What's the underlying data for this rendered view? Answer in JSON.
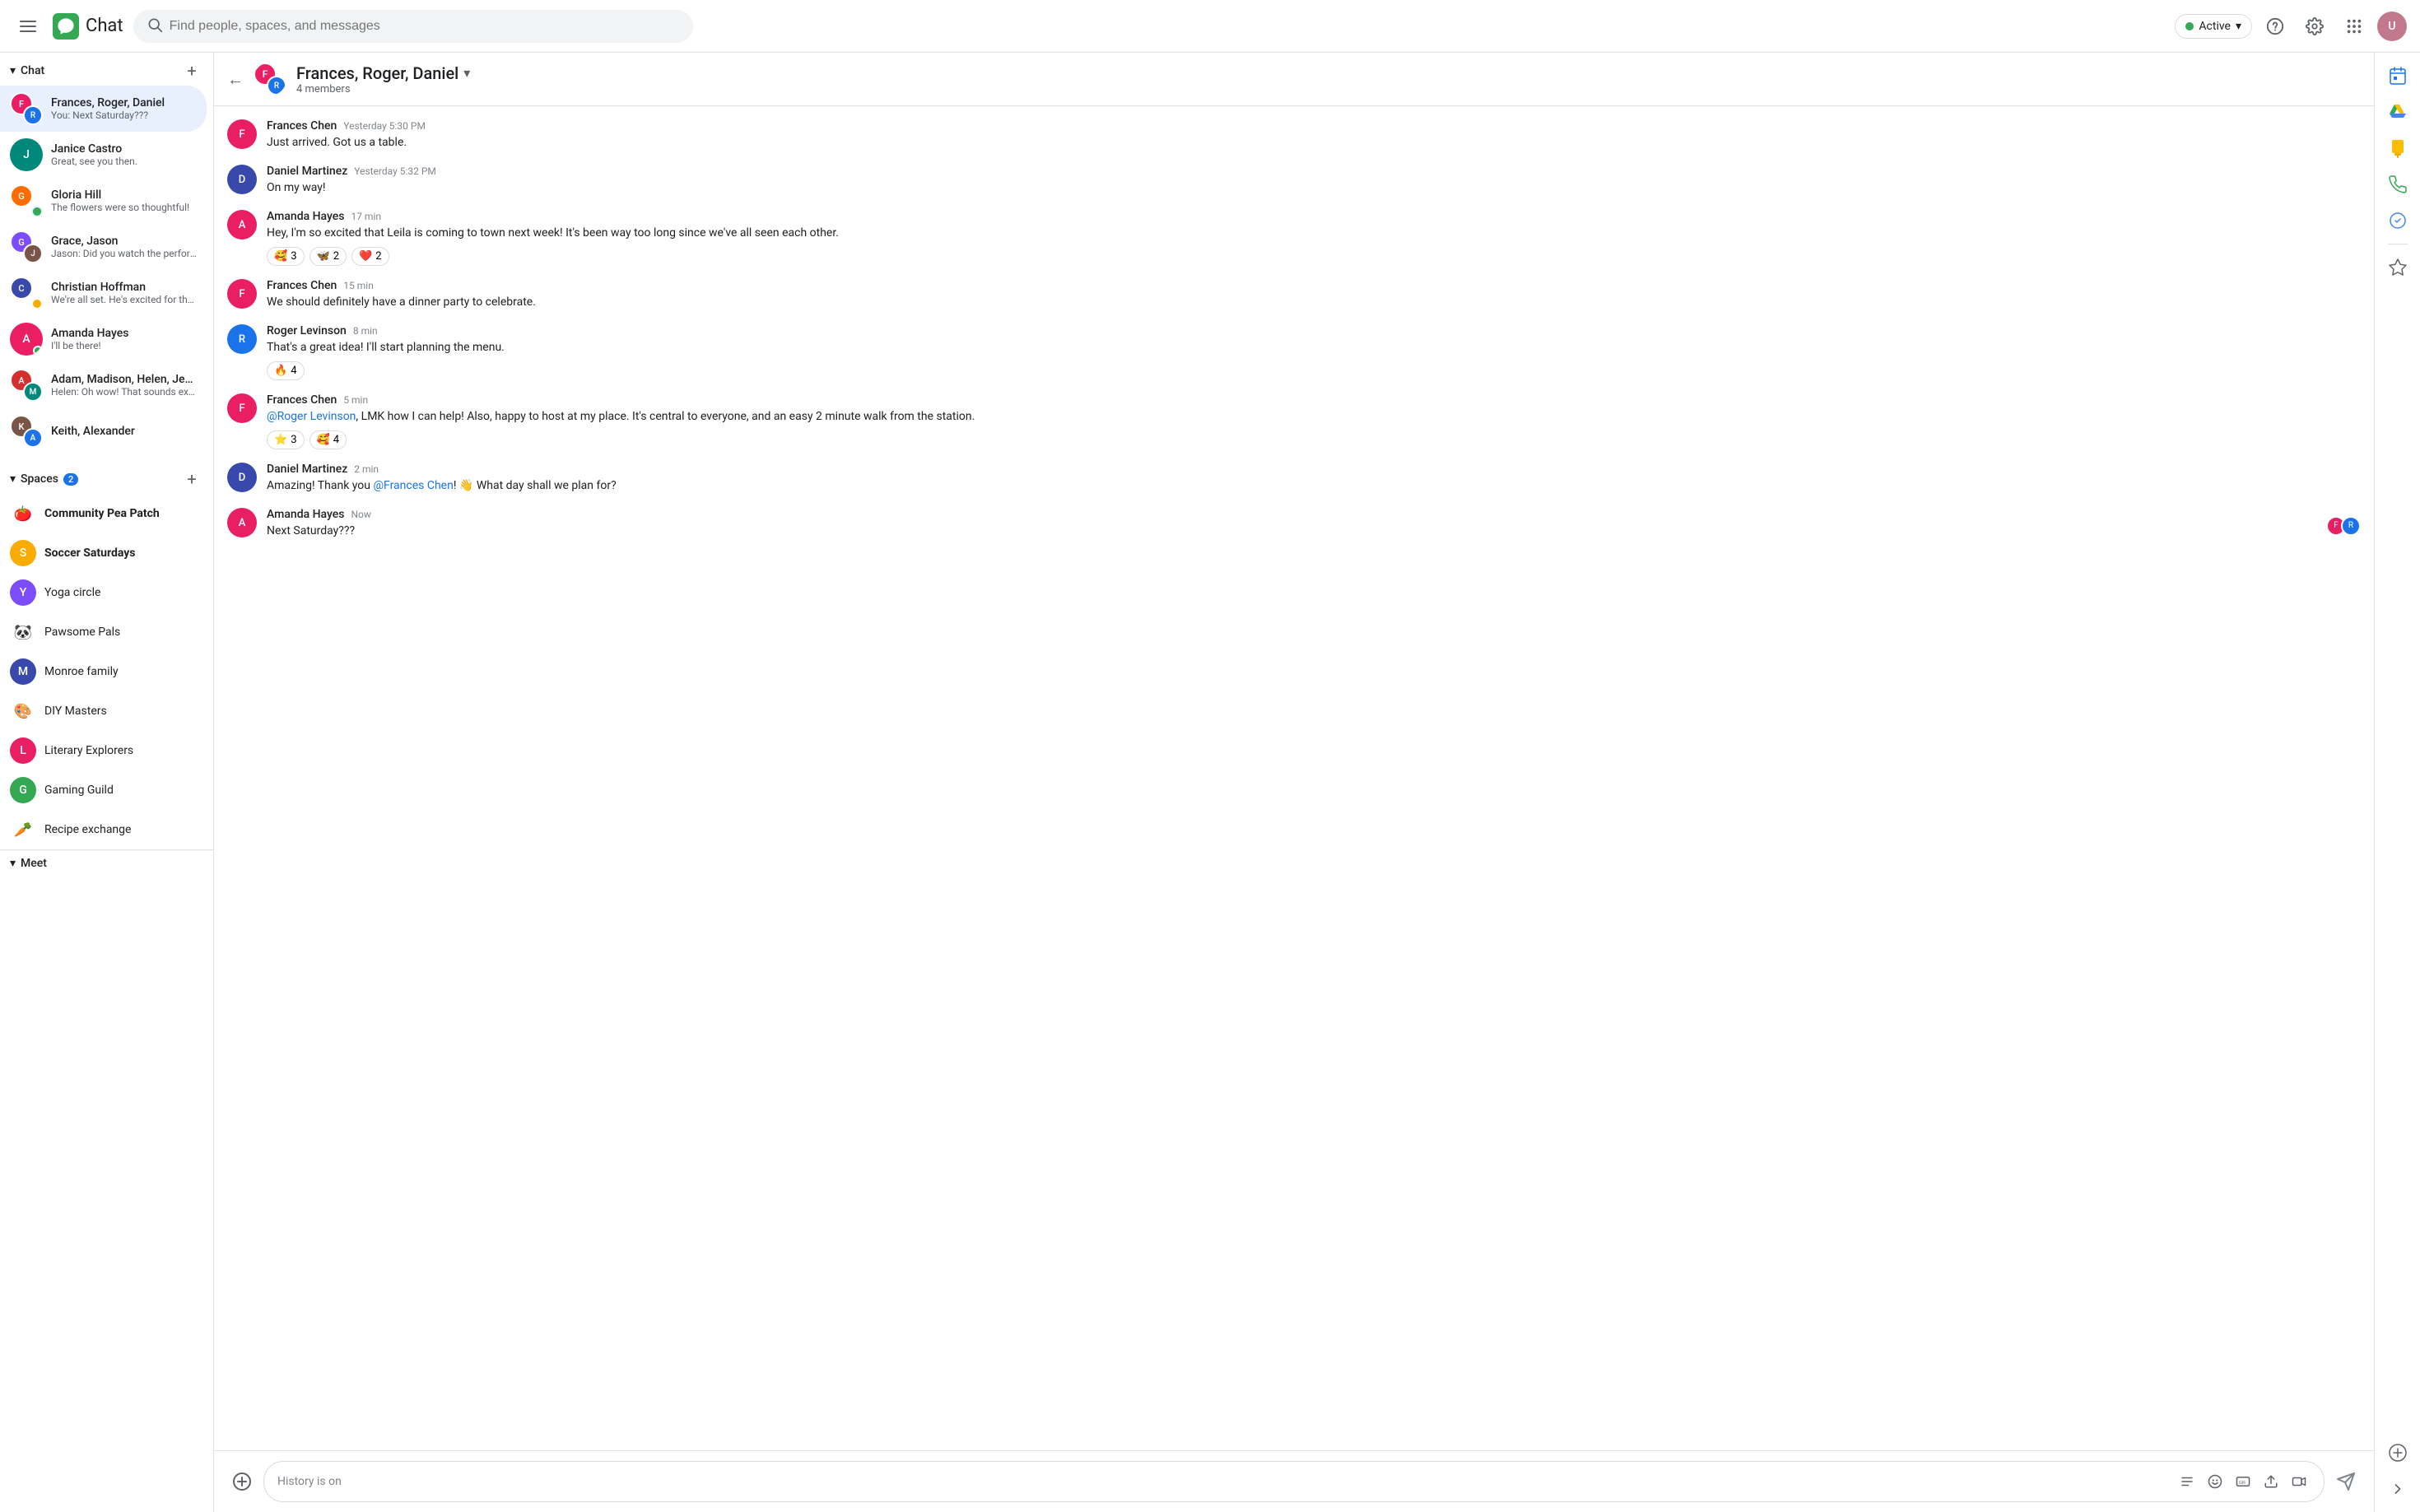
{
  "topbar": {
    "app_name": "Chat",
    "search_placeholder": "Find people, spaces, and messages"
  },
  "active_status": {
    "label": "Active",
    "caret": "▾"
  },
  "sidebar": {
    "chat_section": "Chat",
    "spaces_section": "Spaces",
    "spaces_badge": "2",
    "meet_section": "Meet",
    "chat_items": [
      {
        "id": "frances-roger-daniel",
        "name": "Frances, Roger, Daniel",
        "preview": "You: Next Saturday???",
        "active": true
      },
      {
        "id": "janice-castro",
        "name": "Janice Castro",
        "preview": "Great, see you then.",
        "active": false
      },
      {
        "id": "gloria-hill",
        "name": "Gloria Hill",
        "preview": "The flowers were so thoughtful!",
        "active": false
      },
      {
        "id": "grace-jason",
        "name": "Grace, Jason",
        "preview": "Jason: Did you watch the performan ...",
        "active": false
      },
      {
        "id": "christian-hoffman",
        "name": "Christian Hoffman",
        "preview": "We're all set.  He's excited for the trip.",
        "active": false
      },
      {
        "id": "amanda-hayes",
        "name": "Amanda Hayes",
        "preview": "I'll be there!",
        "active": false
      },
      {
        "id": "adam-madison-helen-jeffrey",
        "name": "Adam, Madison, Helen, Jeffrey",
        "preview": "Helen: Oh wow! That sounds exciting ...",
        "active": false
      },
      {
        "id": "keith-alexander",
        "name": "Keith, Alexander",
        "preview": "",
        "active": false
      }
    ],
    "space_items": [
      {
        "id": "community-pea-patch",
        "name": "Community Pea Patch",
        "icon": "🍅",
        "bold": true,
        "type": "emoji"
      },
      {
        "id": "soccer-saturdays",
        "name": "Soccer Saturdays",
        "letter": "S",
        "bold": true,
        "type": "letter",
        "color": "#f9ab00"
      },
      {
        "id": "yoga-circle",
        "name": "Yoga circle",
        "letter": "Y",
        "bold": false,
        "type": "letter",
        "color": "#7c4dff"
      },
      {
        "id": "pawsome-pals",
        "name": "Pawsome Pals",
        "icon": "🐼",
        "bold": false,
        "type": "emoji"
      },
      {
        "id": "monroe-family",
        "name": "Monroe family",
        "letter": "M",
        "bold": false,
        "type": "letter",
        "color": "#3949ab"
      },
      {
        "id": "diy-masters",
        "name": "DIY Masters",
        "icon": "🎨",
        "bold": false,
        "type": "emoji"
      },
      {
        "id": "literary-explorers",
        "name": "Literary Explorers",
        "letter": "L",
        "bold": false,
        "type": "letter",
        "color": "#e91e63"
      },
      {
        "id": "gaming-guild",
        "name": "Gaming Guild",
        "letter": "G",
        "bold": false,
        "type": "letter",
        "color": "#34a853"
      },
      {
        "id": "recipe-exchange",
        "name": "Recipe exchange",
        "icon": "🥕",
        "bold": false,
        "type": "emoji"
      }
    ]
  },
  "chat_header": {
    "title": "Frances, Roger, Daniel",
    "caret": "▾",
    "members": "4 members"
  },
  "messages": [
    {
      "id": "msg1",
      "sender": "Frances Chen",
      "time": "Yesterday 5:30 PM",
      "text": "Just arrived.  Got us a table.",
      "reactions": []
    },
    {
      "id": "msg2",
      "sender": "Daniel Martinez",
      "time": "Yesterday 5:32 PM",
      "text": "On my way!",
      "reactions": []
    },
    {
      "id": "msg3",
      "sender": "Amanda Hayes",
      "time": "17 min",
      "text": "Hey, I'm so excited that Leila is coming to town next week! It's been way too long since we've all seen each other.",
      "reactions": [
        {
          "emoji": "🥰",
          "count": "3"
        },
        {
          "emoji": "🦋",
          "count": "2"
        },
        {
          "emoji": "❤️",
          "count": "2"
        }
      ]
    },
    {
      "id": "msg4",
      "sender": "Frances Chen",
      "time": "15 min",
      "text": "We should definitely have a dinner party to celebrate.",
      "reactions": []
    },
    {
      "id": "msg5",
      "sender": "Roger Levinson",
      "time": "8 min",
      "text": "That's a great idea! I'll start planning the menu.",
      "reactions": [
        {
          "emoji": "🔥",
          "count": "4"
        }
      ]
    },
    {
      "id": "msg6",
      "sender": "Frances Chen",
      "time": "5 min",
      "text_parts": [
        {
          "type": "link",
          "content": "@Roger Levinson"
        },
        {
          "type": "text",
          "content": ", LMK how I can help!  Also, happy to host at my place. It's central to everyone, and an easy 2 minute walk from the station."
        }
      ],
      "reactions": [
        {
          "emoji": "⭐",
          "count": "3"
        },
        {
          "emoji": "🥰",
          "count": "4"
        }
      ]
    },
    {
      "id": "msg7",
      "sender": "Daniel Martinez",
      "time": "2 min",
      "text_parts": [
        {
          "type": "text",
          "content": "Amazing! Thank you "
        },
        {
          "type": "link",
          "content": "@Frances Chen"
        },
        {
          "type": "text",
          "content": "! 👋 What day shall we plan for?"
        }
      ],
      "reactions": []
    },
    {
      "id": "msg8",
      "sender": "Amanda Hayes",
      "time": "Now",
      "text": "Next Saturday???",
      "reactions": []
    }
  ],
  "input": {
    "placeholder": "History is on"
  },
  "right_sidebar_icons": [
    "calendar",
    "drive",
    "keep",
    "phone",
    "tasks",
    "star"
  ]
}
